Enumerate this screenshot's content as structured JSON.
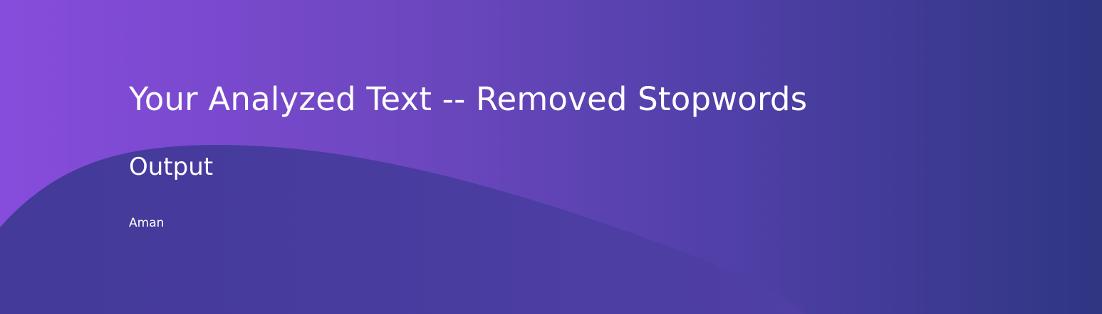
{
  "page": {
    "title": "Your Analyzed Text -- Removed Stopwords",
    "subtitle": "Output",
    "output_text": "Aman"
  },
  "colors": {
    "gradient_start": "#874cdc",
    "gradient_end": "#2f3682",
    "wave_fill": "#4a3ca1",
    "text": "#ffffff"
  }
}
